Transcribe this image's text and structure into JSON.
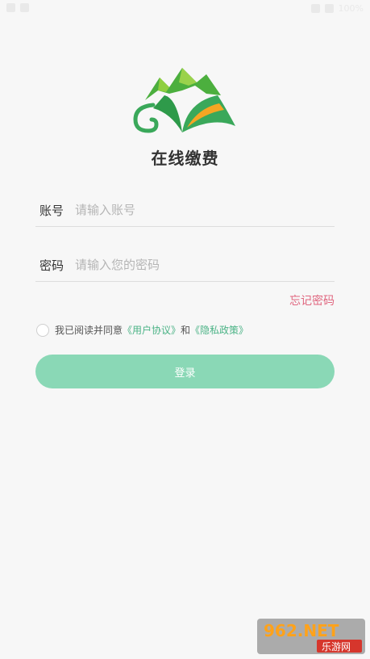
{
  "status_bar": {
    "battery": "100%"
  },
  "app": {
    "title": "在线缴费"
  },
  "form": {
    "account_label": "账号",
    "account_placeholder": "请输入账号",
    "account_value": "",
    "password_label": "密码",
    "password_placeholder": "请输入您的密码",
    "password_value": "",
    "forgot_label": "忘记密码"
  },
  "agreement": {
    "prefix": "我已阅读并同意",
    "user_agreement": "《用户协议》",
    "and": "和",
    "privacy_policy": "《隐私政策》",
    "checked": false
  },
  "login": {
    "label": "登录"
  },
  "watermark": {
    "top_text": "962.NET",
    "bottom_text": "乐游网"
  },
  "colors": {
    "primary": "#8ad8b6",
    "link_green": "#4bb386",
    "forgot_pink": "#e0667f",
    "logo_green": "#3aa85a",
    "logo_orange": "#f5a623"
  }
}
